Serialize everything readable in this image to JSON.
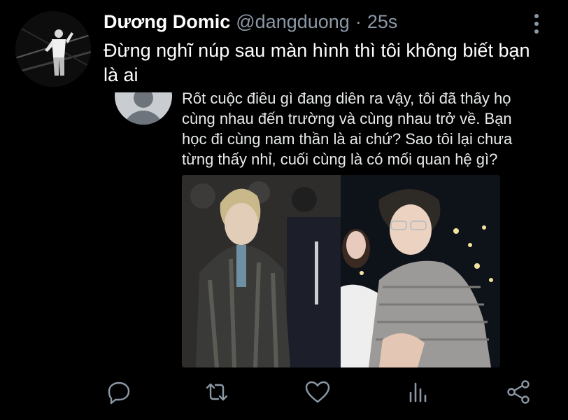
{
  "tweet": {
    "author_name": "Dương Domic",
    "handle": "@dangduong",
    "separator": "·",
    "time": "25s",
    "text": "Đừng nghĩ núp sau màn hình thì tôi không biết bạn là ai"
  },
  "quoted": {
    "text": "Rốt cuộc điều gì đang diễn ra vậy, tôi đã thấy họ cùng nhau đến trường và cùng nhau trở về. Bạn học đi cùng nam thần là ai chứ? Sao tôi lại chưa từng thấy nhỉ, cuối cùng là có mối quan hệ gì?"
  },
  "icons": {
    "more": "more-vertical-icon",
    "reply": "reply-icon",
    "retweet": "retweet-icon",
    "like": "heart-icon",
    "views": "views-icon",
    "share": "share-icon"
  },
  "colors": {
    "background": "#000000",
    "text": "#ffffff",
    "secondary": "#8b98a5"
  }
}
